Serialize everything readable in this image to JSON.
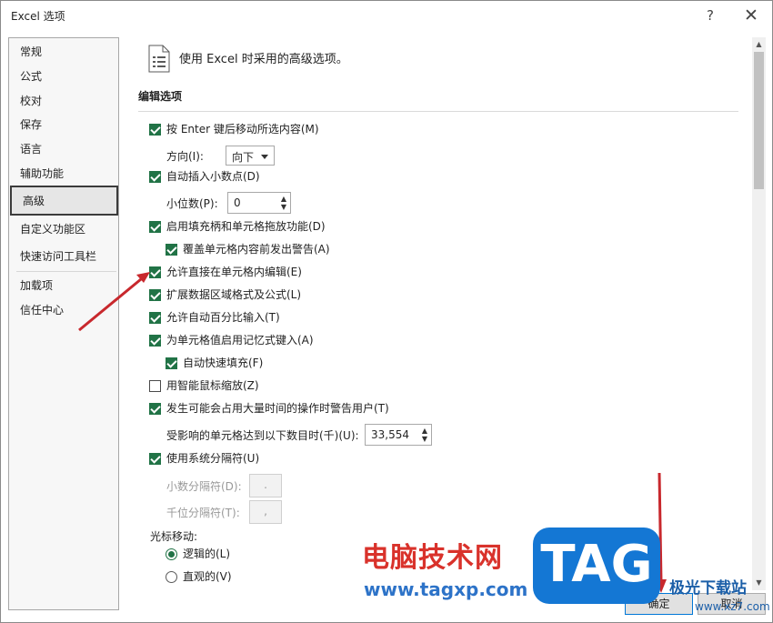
{
  "window": {
    "title": "Excel 选项",
    "help": "?",
    "close": "✕"
  },
  "nav": {
    "items": [
      "常规",
      "公式",
      "校对",
      "保存",
      "语言",
      "辅助功能",
      "高级",
      "自定义功能区",
      "快速访问工具栏",
      "加载项",
      "信任中心"
    ],
    "active": "高级"
  },
  "header": {
    "text": "使用 Excel 时采用的高级选项。",
    "icon": "document-icon"
  },
  "section": {
    "title": "编辑选项"
  },
  "options": {
    "enter_move": "按 Enter 键后移动所选内容(M)",
    "direction_label": "方向(I):",
    "direction_value": "向下",
    "auto_decimal": "自动插入小数点(D)",
    "places_label": "小位数(P):",
    "places_value": "0",
    "fill_handle": "启用填充柄和单元格拖放功能(D)",
    "alert_overwrite": "覆盖单元格内容前发出警告(A)",
    "edit_in_cell": "允许直接在单元格内编辑(E)",
    "extend_formats": "扩展数据区域格式及公式(L)",
    "auto_percent": "允许自动百分比输入(T)",
    "autocomplete": "为单元格值启用记忆式键入(A)",
    "flash_fill": "自动快速填充(F)",
    "zoom_intellimouse": "用智能鼠标缩放(Z)",
    "alert_slow": "发生可能会占用大量时间的操作时警告用户(T)",
    "cells_label": "受影响的单元格达到以下数目时(千)(U):",
    "cells_value": "33,554",
    "system_separators": "使用系统分隔符(U)",
    "decimal_sep_label": "小数分隔符(D):",
    "decimal_sep_value": ".",
    "thousands_sep_label": "千位分隔符(T):",
    "thousands_sep_value": ",",
    "cursor_movement": "光标移动:",
    "logical": "逻辑的(L)",
    "visual": "直观的(V)"
  },
  "buttons": {
    "ok": "确定",
    "cancel": "取消"
  },
  "watermark": {
    "cn": "电脑技术网",
    "url": "www.tagxp.com",
    "tag": "TAG",
    "site": "极光下载站",
    "site2": "www.xz7.com"
  },
  "colors": {
    "accent": "#217346",
    "annotation": "#c8282d"
  }
}
